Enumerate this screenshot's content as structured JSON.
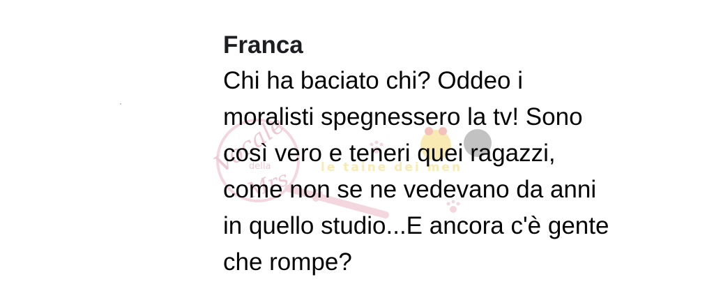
{
  "comment": {
    "author": "Franca",
    "text": "Chi ha baciato chi? Oddeo i\nmoralisti spegnessero la tv! Sono\ncosì vero e teneri quei ragazzi,\ncome non se ne vedevano da anni\nin quello studio...E ancora c'è gente\nche rompe?"
  },
  "watermark": {
    "logo_script": "Vocale",
    "logo_small": "della",
    "logo_script2": "Mrs",
    "banner_text": "le taine dei men"
  },
  "colors": {
    "author": "#1c1e21",
    "text": "#050505",
    "watermark_pink": "#e8a7b8",
    "watermark_yellow": "#f2cf57"
  }
}
